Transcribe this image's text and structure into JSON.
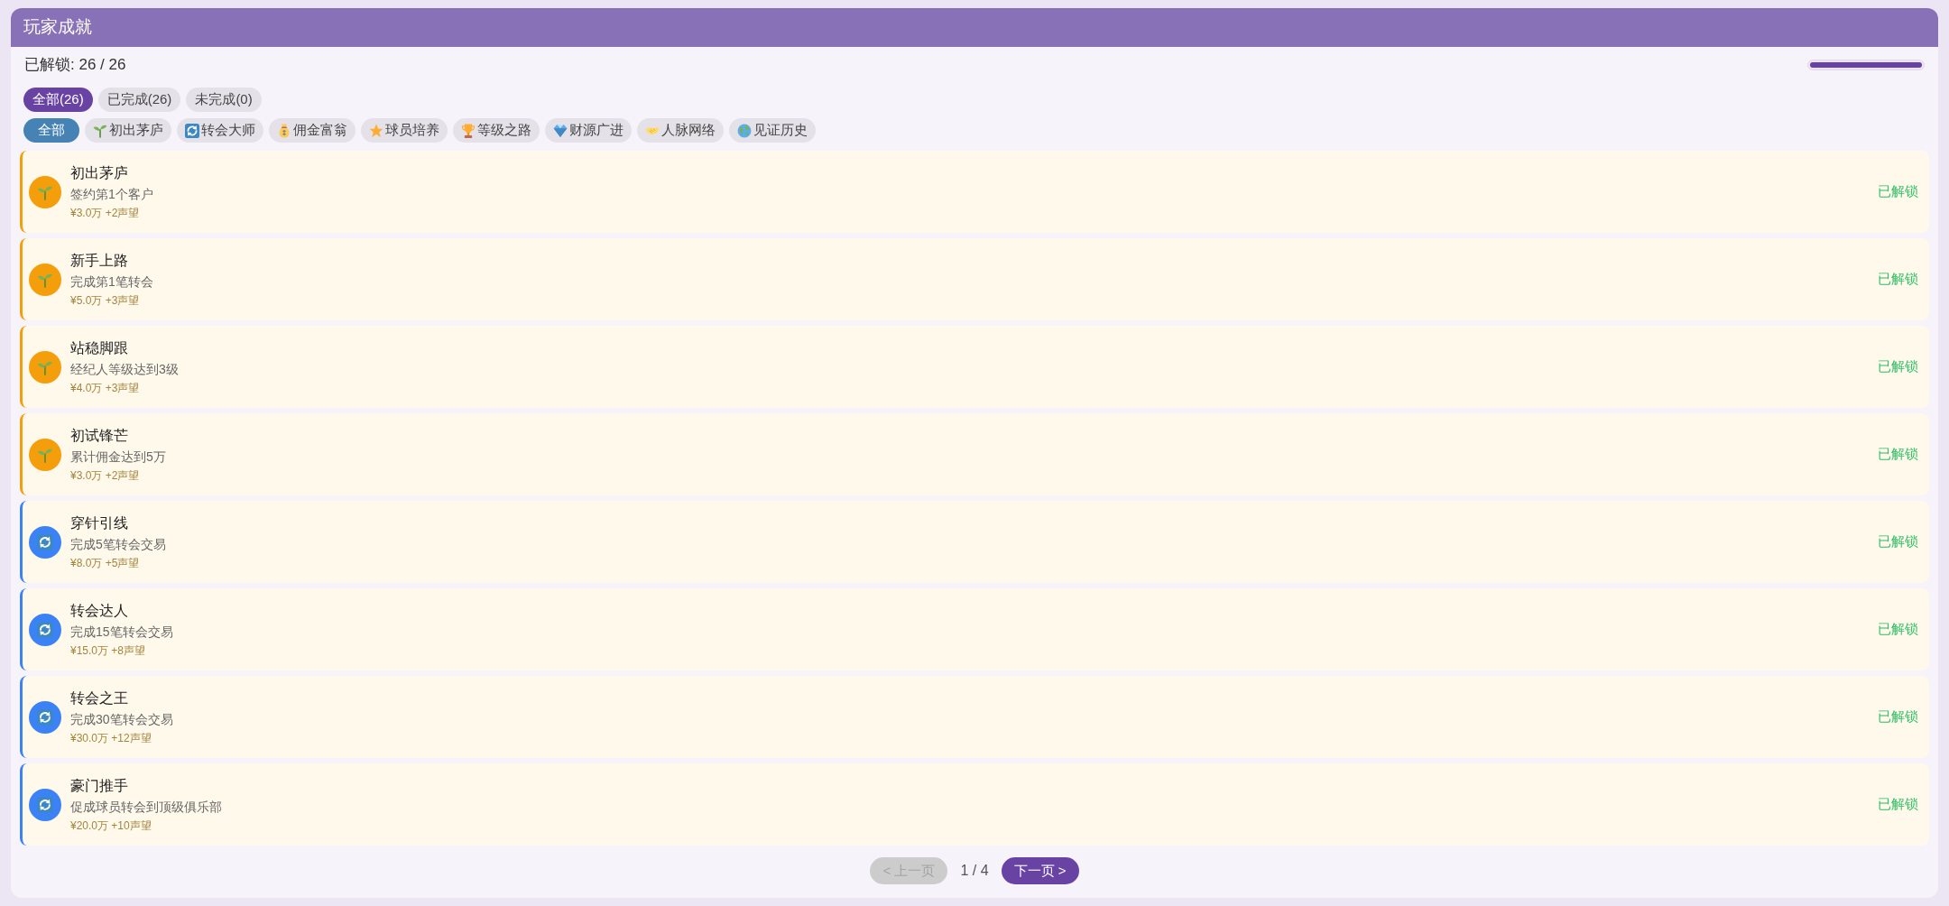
{
  "title": "玩家成就",
  "summary": {
    "label": "已解锁: 26 / 26",
    "level": 1
  },
  "status_tabs": [
    {
      "label": "全部(26)",
      "selected": true
    },
    {
      "label": "已完成(26)",
      "selected": false
    },
    {
      "label": "未完成(0)",
      "selected": false
    }
  ],
  "category_chips": [
    {
      "kind": "plain",
      "label": "全部",
      "selected": true
    },
    {
      "kind": "sprout",
      "label": "初出茅庐",
      "selected": false
    },
    {
      "kind": "cycle",
      "label": "转会大师",
      "selected": false
    },
    {
      "kind": "moneybag",
      "label": "佣金富翁",
      "selected": false
    },
    {
      "kind": "star",
      "label": "球员培养",
      "selected": false
    },
    {
      "kind": "trophy",
      "label": "等级之路",
      "selected": false
    },
    {
      "kind": "gem",
      "label": "财源广进",
      "selected": false
    },
    {
      "kind": "handshake",
      "label": "人脉网络",
      "selected": false
    },
    {
      "kind": "globe",
      "label": "见证历史",
      "selected": false
    }
  ],
  "achievements": [
    {
      "kind": "sprout",
      "color": "#f59e0b",
      "title": "初出茅庐",
      "description": "签约第1个客户",
      "reward": "¥3.0万 +2声望",
      "status": "已解锁"
    },
    {
      "kind": "sprout",
      "color": "#f59e0b",
      "title": "新手上路",
      "description": "完成第1笔转会",
      "reward": "¥5.0万 +3声望",
      "status": "已解锁"
    },
    {
      "kind": "sprout",
      "color": "#f59e0b",
      "title": "站稳脚跟",
      "description": "经纪人等级达到3级",
      "reward": "¥4.0万 +3声望",
      "status": "已解锁"
    },
    {
      "kind": "sprout",
      "color": "#f59e0b",
      "title": "初试锋芒",
      "description": "累计佣金达到5万",
      "reward": "¥3.0万 +2声望",
      "status": "已解锁"
    },
    {
      "kind": "cycle",
      "color": "#3b82f6",
      "title": "穿针引线",
      "description": "完成5笔转会交易",
      "reward": "¥8.0万 +5声望",
      "status": "已解锁"
    },
    {
      "kind": "cycle",
      "color": "#3b82f6",
      "title": "转会达人",
      "description": "完成15笔转会交易",
      "reward": "¥15.0万 +8声望",
      "status": "已解锁"
    },
    {
      "kind": "cycle",
      "color": "#3b82f6",
      "title": "转会之王",
      "description": "完成30笔转会交易",
      "reward": "¥30.0万 +12声望",
      "status": "已解锁"
    },
    {
      "kind": "cycle",
      "color": "#3b82f6",
      "title": "豪门推手",
      "description": "促成球员转会到顶级俱乐部",
      "reward": "¥20.0万 +10声望",
      "status": "已解锁"
    }
  ],
  "pagination": {
    "prev": {
      "label": "< 上一页",
      "disabled": true
    },
    "page": "1 / 4",
    "next": {
      "label": "下一页 >",
      "disabled": false
    }
  }
}
